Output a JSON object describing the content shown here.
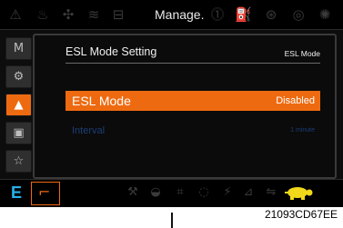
{
  "top_bar": {
    "title": "Manage.",
    "left_icons": [
      "warning-triangle-icon",
      "coolant-temp-icon",
      "engine-icon",
      "hydraulic-oil-icon",
      "battery-icon"
    ],
    "right_icons": [
      "brake-icon",
      "fuel-icon",
      "engine-check-icon",
      "oil-pressure-icon",
      "preheat-icon"
    ]
  },
  "sidebar": {
    "items": [
      {
        "label": "M",
        "icon": "menu-m-icon",
        "active": false
      },
      {
        "label": "⚙",
        "icon": "gear-icon",
        "active": false
      },
      {
        "label": "▲",
        "icon": "user-icon",
        "active": true
      },
      {
        "label": "▣",
        "icon": "display-icon",
        "active": false
      },
      {
        "label": "☆",
        "icon": "star-icon",
        "active": false
      }
    ]
  },
  "panel": {
    "title": "ESL Mode Setting",
    "title_right": "ESL Mode",
    "rows": [
      {
        "label": "ESL Mode",
        "value": "Disabled",
        "selected": true
      },
      {
        "label": "Interval",
        "value": "1 minute",
        "selected": false
      }
    ]
  },
  "bottom_bar": {
    "mode_letter": "E",
    "mode_button_icon": "boom-mode-icon",
    "icons": [
      "work-tool-icon",
      "cup-icon",
      "grid-icon",
      "tank-icon",
      "power-mode-icon",
      "tool-icon",
      "swing-icon",
      "turtle-icon"
    ]
  },
  "caption": "21093CD67EE",
  "colors": {
    "accent": "#ee6a10",
    "screen_bg": "#0d0d0d",
    "dim_text": "#1b3e78",
    "mode_letter": "#27b1e8",
    "turtle": "#f2d81a"
  }
}
